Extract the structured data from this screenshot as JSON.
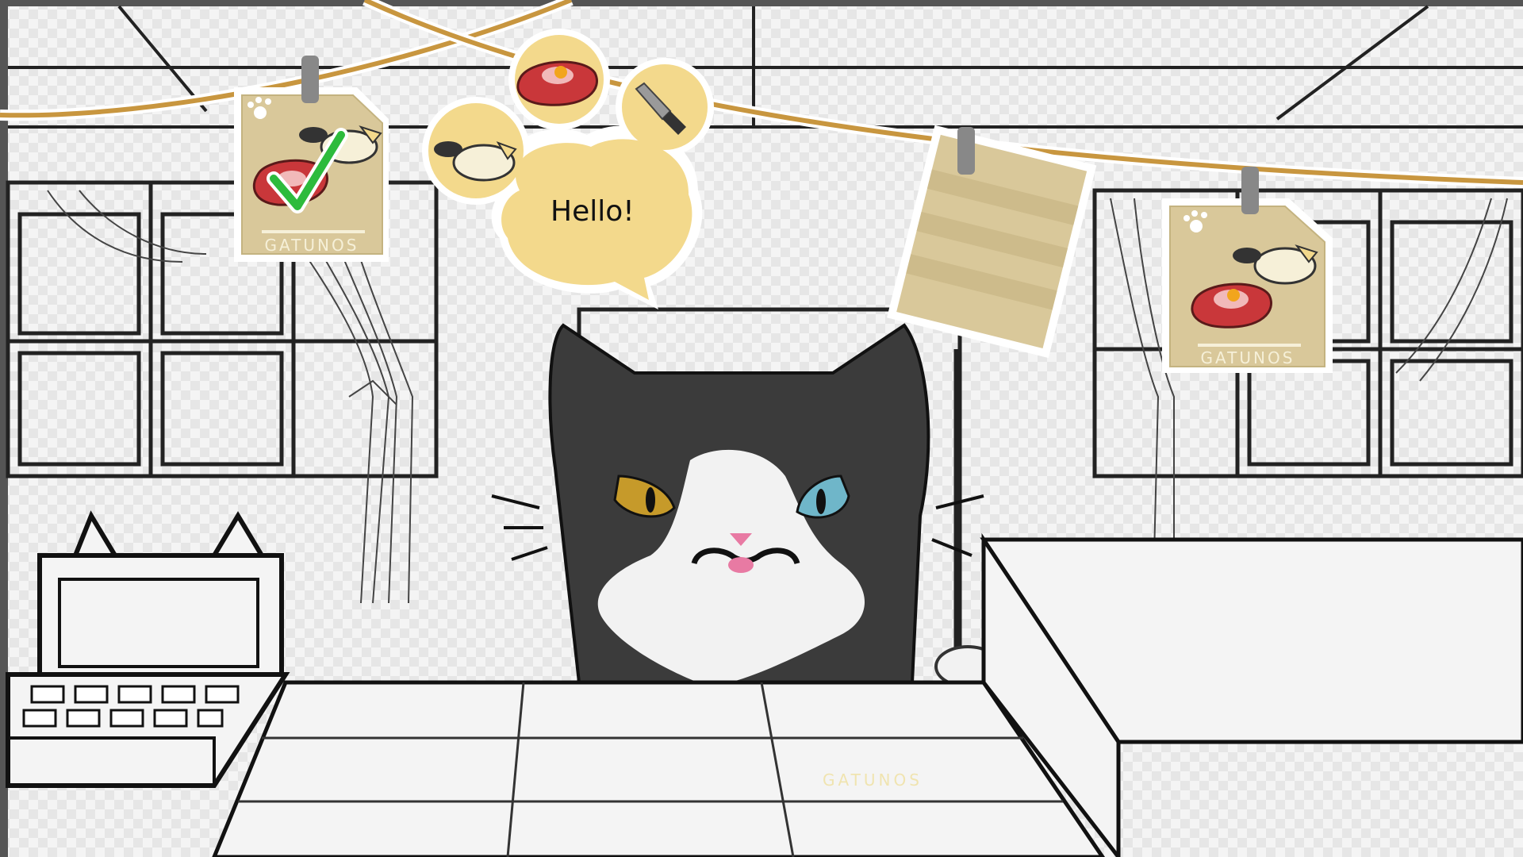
{
  "speech": {
    "text": "Hello!"
  },
  "order_cards": [
    {
      "brand": "GATUNOS",
      "completed": true,
      "items": [
        "steak-egg",
        "tuna-bowl"
      ]
    },
    {
      "brand": "",
      "completed": false,
      "items": []
    },
    {
      "brand": "GATUNOS",
      "completed": false,
      "items": [
        "tuna-bowl",
        "steak-egg"
      ]
    }
  ],
  "thought_bubble_items": [
    "tuna-bowl-icon",
    "steak-egg-icon",
    "knife-icon"
  ],
  "counter": {
    "brand": "GATUNOS"
  },
  "colors": {
    "card_bg": "#d9c89a",
    "bubble_bg": "#f3d98c",
    "string": "#c8963f",
    "check": "#2dbb3c",
    "cat_fur": "#3b3b3b",
    "eye_left": "#c69a2a",
    "eye_right": "#6fb6c9"
  }
}
